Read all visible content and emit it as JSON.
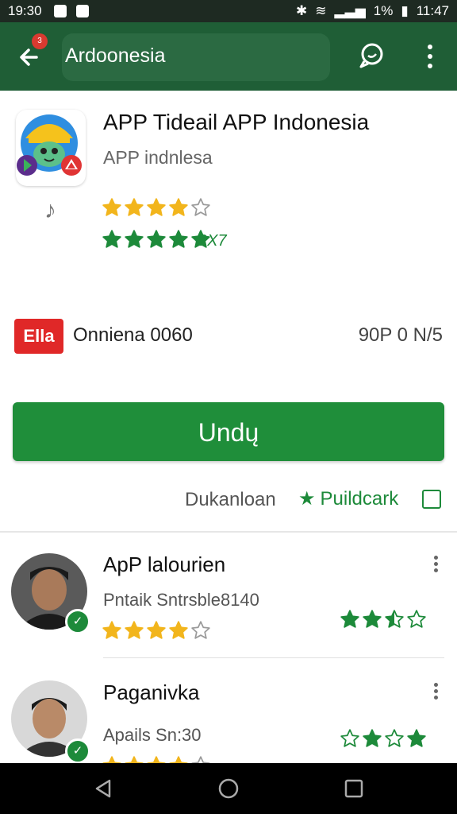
{
  "status_bar": {
    "time_left": "19:30",
    "battery": "1%",
    "time_right": "11:47"
  },
  "app_bar": {
    "notification_count": "3",
    "search_value": "Ardoonesia",
    "icons": [
      "back-arrow-icon",
      "chat-icon",
      "more-vert-icon"
    ]
  },
  "app": {
    "title": "APP Tideail APP Indonesia",
    "subtitle": "APP indnlesa",
    "rating_primary": 4,
    "rating_secondary": 5,
    "rating_secondary_text": "2X7"
  },
  "developer": {
    "logo_text": "Ella",
    "name": "Onniena 0060",
    "meta": "90P 0 N/5"
  },
  "install_label": "Undų",
  "actions": {
    "left": "Dukanloan",
    "right": "Puildcark"
  },
  "reviews": [
    {
      "name": "ApP lalourien",
      "subtitle": "Pntaik Sntrsble8140",
      "left_rating": 4,
      "right_rating_pattern": [
        "full",
        "full",
        "half",
        "empty"
      ]
    },
    {
      "name": "Paganivka",
      "subtitle": "Apails Sn:30",
      "left_rating": 4,
      "right_rating_pattern": [
        "empty",
        "full",
        "empty",
        "full"
      ]
    }
  ],
  "colors": {
    "app_bar": "#1f5e36",
    "accent_green": "#1f8e3a",
    "star_gold": "#f2b51c",
    "star_green": "#1d8a3a"
  }
}
